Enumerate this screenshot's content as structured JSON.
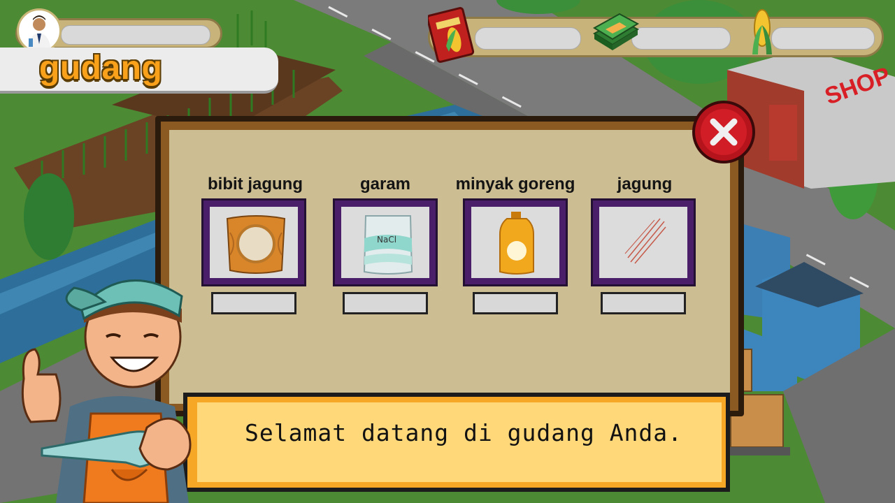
{
  "screen": {
    "title": "gudang"
  },
  "hud": {
    "player_avatar_icon": "farmer-avatar-icon",
    "resources": [
      {
        "icon": "corn-seed-pack-icon",
        "value": ""
      },
      {
        "icon": "money-stack-icon",
        "value": ""
      },
      {
        "icon": "corn-icon",
        "value": ""
      }
    ]
  },
  "warehouse": {
    "close_icon": "close-x-icon",
    "items": [
      {
        "label": "bibit jagung",
        "icon": "seed-sack-icon",
        "quantity": ""
      },
      {
        "label": "garam",
        "icon": "salt-bag-icon",
        "icon_text": "NaCl",
        "quantity": ""
      },
      {
        "label": "minyak goreng",
        "icon": "cooking-oil-bottle-icon",
        "quantity": ""
      },
      {
        "label": "jagung",
        "icon": "corn-sketch-icon",
        "quantity": ""
      }
    ]
  },
  "dialogue": {
    "speaker_icon": "shopkeeper-character",
    "text": "Selamat datang di gudang Anda."
  },
  "background": {
    "shop_sign": "SHOP"
  },
  "colors": {
    "title": "#f9a11b",
    "close_button": "#d11d25",
    "item_frame": "#4b1e6a",
    "dialog_bg": "#ffd87a",
    "dialog_border": "#f7a726"
  }
}
